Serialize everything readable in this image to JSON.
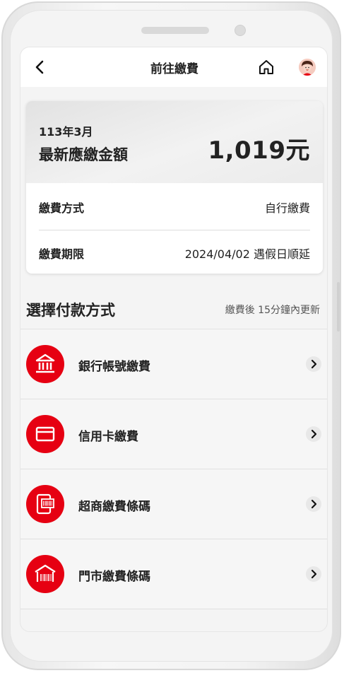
{
  "header": {
    "title": "前往繳費",
    "back_icon": "chevron-left-icon",
    "home_icon": "home-icon",
    "avatar_icon": "avatar-icon"
  },
  "bill": {
    "period": "113年3月",
    "amount_label": "最新應繳金額",
    "amount": "1,019元",
    "rows": [
      {
        "key": "繳費方式",
        "value": "自行繳費"
      },
      {
        "key": "繳費期限",
        "value": "2024/04/02 遇假日順延"
      }
    ]
  },
  "payment": {
    "title": "選擇付款方式",
    "note": "繳費後 15分鐘內更新",
    "items": [
      {
        "label": "銀行帳號繳費",
        "icon": "bank-icon"
      },
      {
        "label": "信用卡繳費",
        "icon": "credit-card-icon"
      },
      {
        "label": "超商繳費條碼",
        "icon": "phone-barcode-icon"
      },
      {
        "label": "門市繳費條碼",
        "icon": "store-barcode-icon"
      }
    ]
  },
  "colors": {
    "accent": "#e60012",
    "background": "#f4f4f4"
  }
}
